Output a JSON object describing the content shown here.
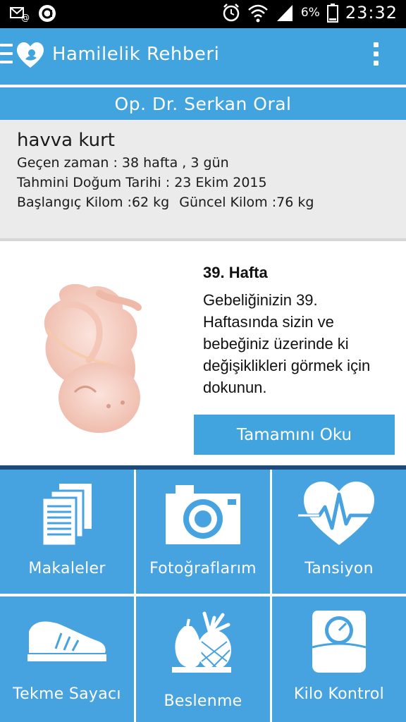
{
  "status_bar": {
    "battery_percent": "6%",
    "time": "23:32"
  },
  "app_bar": {
    "title": "Hamilelik Rehberi"
  },
  "doctor": {
    "name": "Op. Dr. Serkan Oral"
  },
  "profile": {
    "name": "havva kurt",
    "elapsed": "Geçen zaman : 38 hafta , 3 gün",
    "due_date": "Tahmini Doğum Tarihi : 23 Ekim 2015",
    "start_weight": "Başlangıç Kilom :62 kg",
    "current_weight": "Güncel Kilom :76 kg"
  },
  "week_card": {
    "title": "39. Hafta",
    "description": "Gebeliğinizin 39. Haftasında sizin ve bebeğiniz üzerinde ki değişiklikleri görmek için dokunun.",
    "button_label": "Tamamını Oku"
  },
  "menu": [
    {
      "label": "Makaleler",
      "icon": "documents-icon"
    },
    {
      "label": "Fotoğraflarım",
      "icon": "camera-icon"
    },
    {
      "label": "Tansiyon",
      "icon": "heartbeat-icon"
    },
    {
      "label": "Tekme Sayacı",
      "icon": "shoe-icon"
    },
    {
      "label": "Beslenme",
      "icon": "fruits-icon"
    },
    {
      "label": "Kilo Kontrol",
      "icon": "scale-icon"
    }
  ],
  "colors": {
    "primary": "#42a4de",
    "tile": "#47a2e0",
    "divider": "#1d4a78",
    "info_bg": "#ebebeb"
  }
}
